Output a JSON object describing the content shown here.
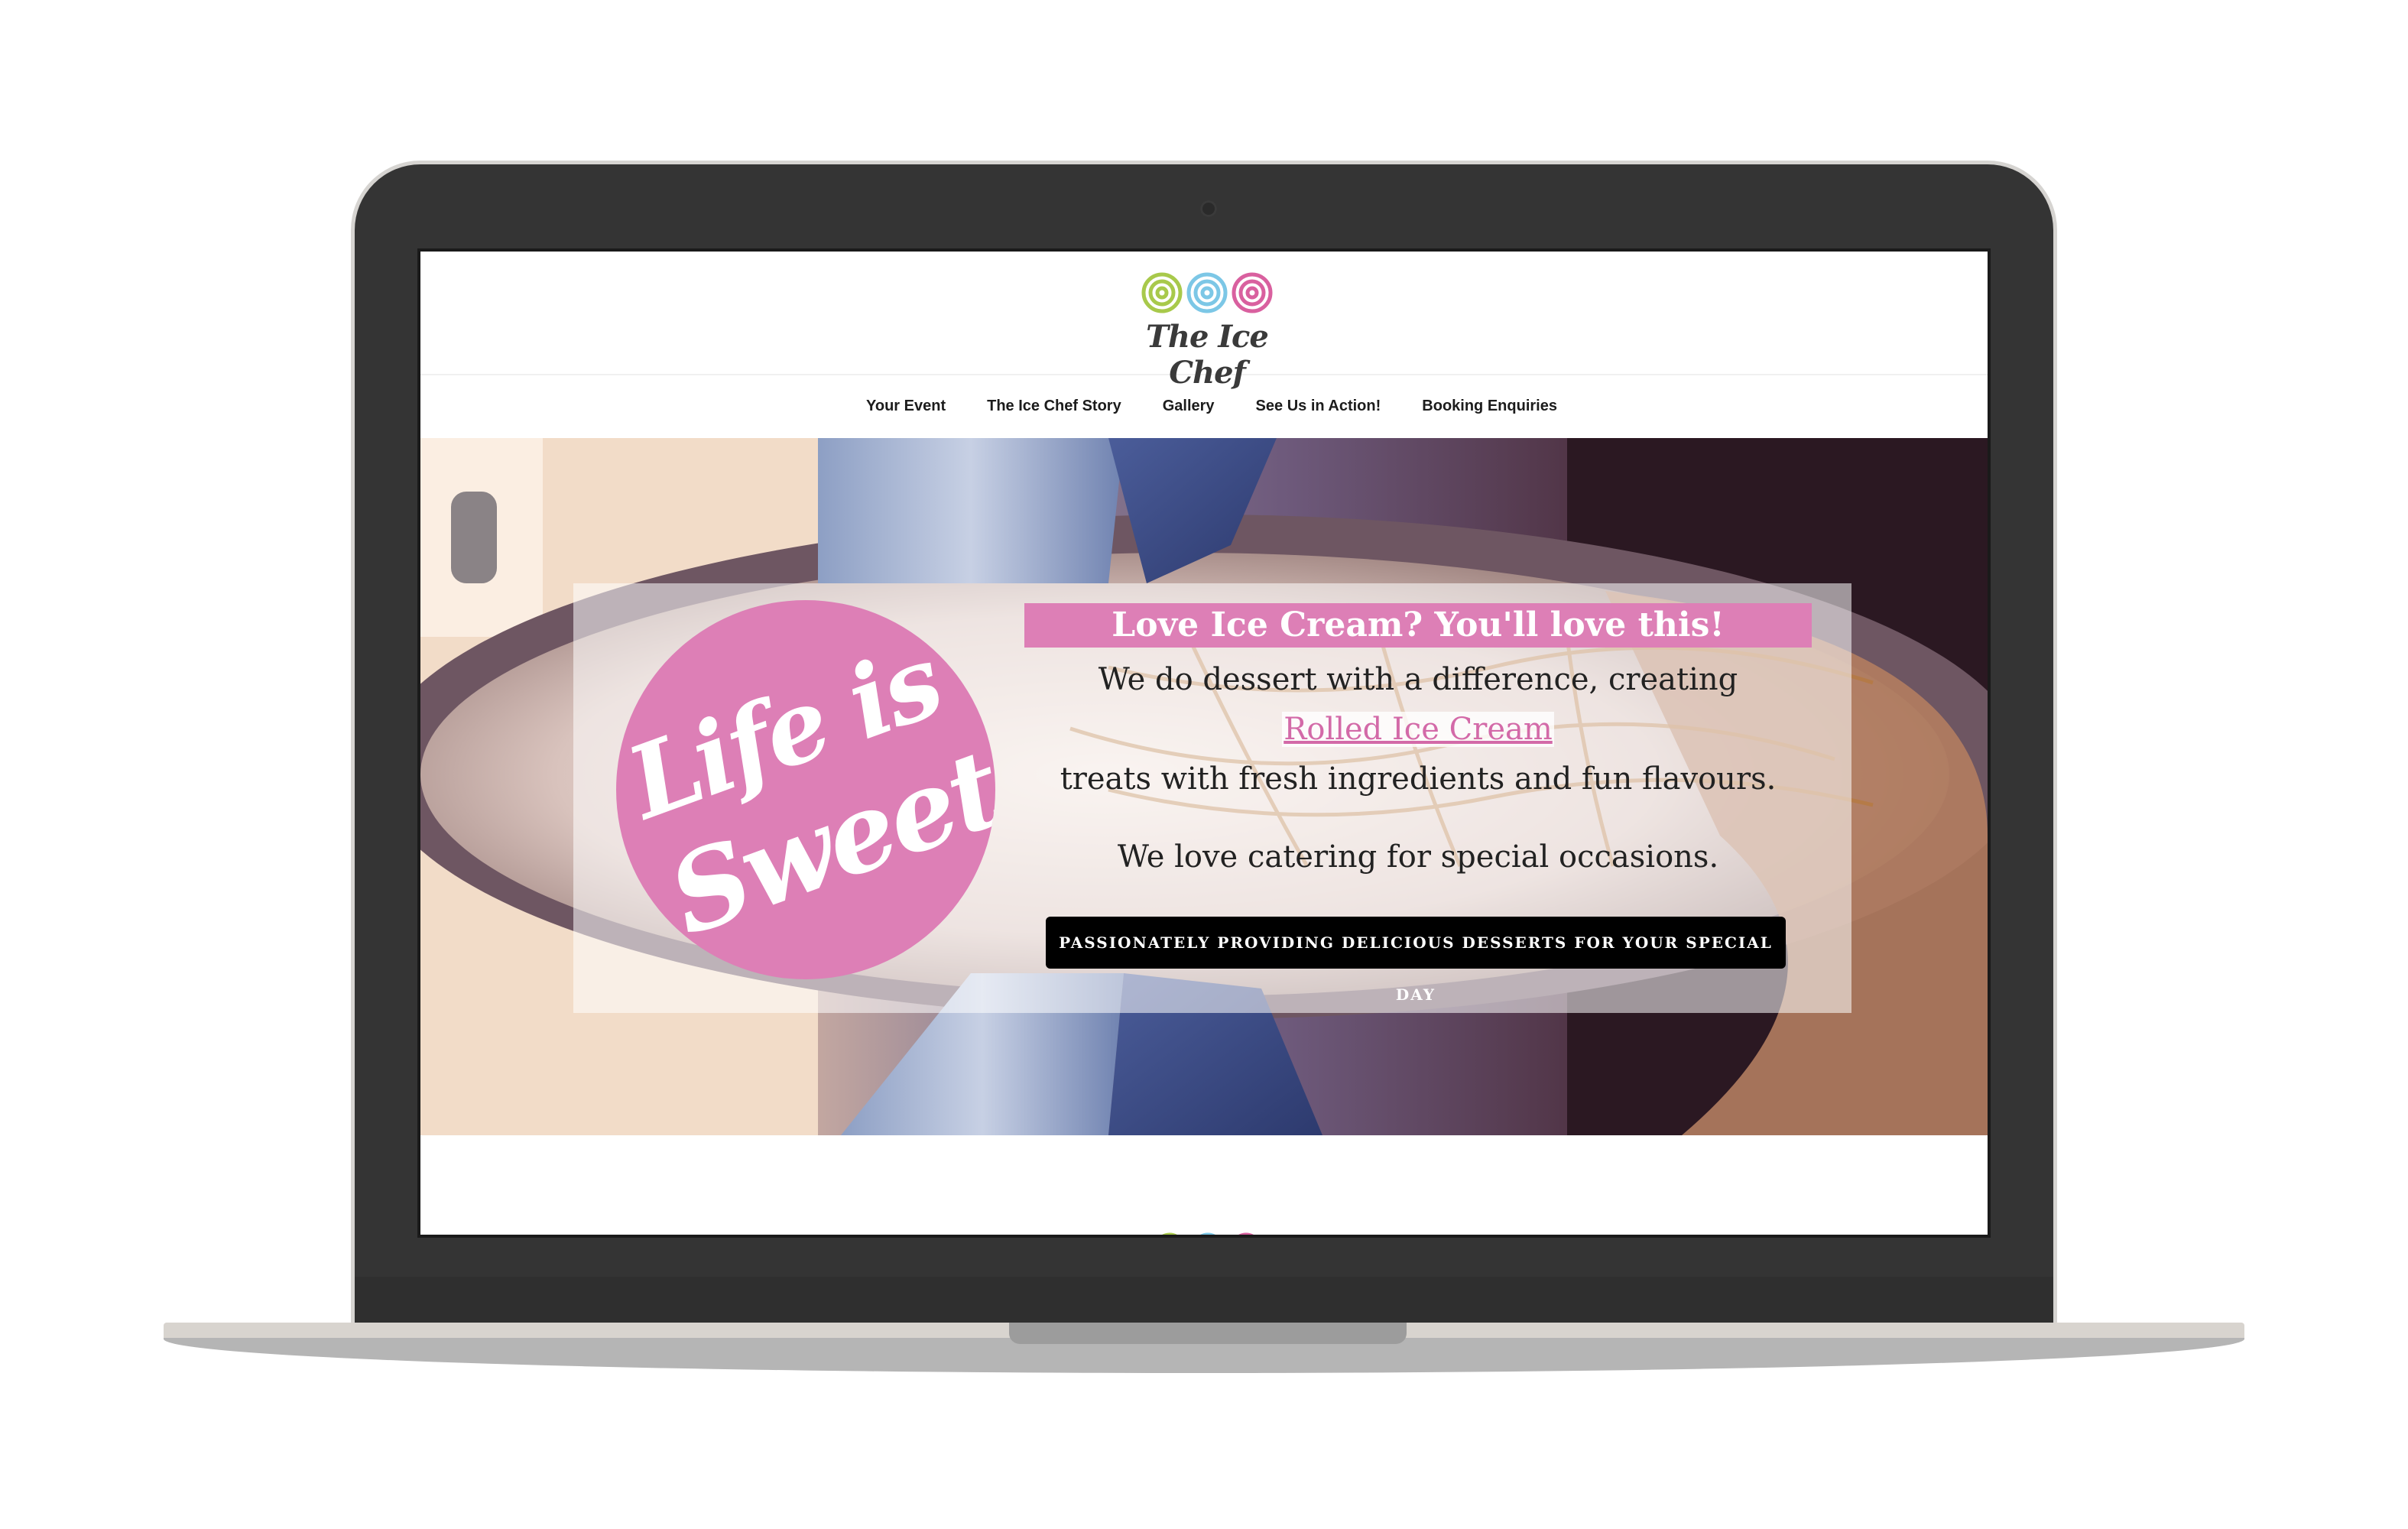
{
  "site": {
    "brand": "The Ice Chef",
    "logo_colors": [
      "#a8c94b",
      "#7cc7e6",
      "#d9609f"
    ]
  },
  "nav": {
    "items": [
      {
        "label": "Your Event"
      },
      {
        "label": "The Ice Chef Story"
      },
      {
        "label": "Gallery"
      },
      {
        "label": "See Us in Action!"
      },
      {
        "label": "Booking Enquiries"
      }
    ]
  },
  "hero": {
    "badge_line1": "Life is",
    "badge_line2": "Sweet",
    "headline": "Love Ice Cream? You'll love this!",
    "line1": "We do dessert with a difference, creating",
    "link": "Rolled Ice Cream",
    "line2": "treats with fresh ingredients and fun flavours.",
    "line3": "We love catering for special occasions.",
    "cta": "PASSIONATELY PROVIDING DELICIOUS DESSERTS FOR YOUR SPECIAL DAY"
  },
  "colors": {
    "accent_pink": "#dd7fb6",
    "link_pink": "#d36aa8",
    "cta_bg": "#000000"
  }
}
